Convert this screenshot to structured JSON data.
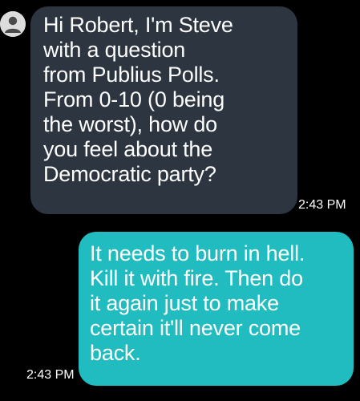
{
  "conversation": {
    "incoming": {
      "lines": [
        "Hi Robert, I'm Steve",
        "with a question",
        "from Publius Polls.",
        "From 0-10 (0 being",
        "the worst), how do",
        "you feel about the",
        "Democratic party?"
      ],
      "time": "2:43 PM",
      "avatar_icon": "person-icon"
    },
    "outgoing": {
      "lines": [
        "It needs to burn in hell.",
        "Kill it with fire. Then do",
        "it again just to make",
        "certain it'll never come",
        "back."
      ],
      "time": "2:43 PM"
    }
  },
  "colors": {
    "background": "#000000",
    "incoming_bubble": "#2c3540",
    "outgoing_bubble": "#21bcbf",
    "text": "#ffffff"
  }
}
